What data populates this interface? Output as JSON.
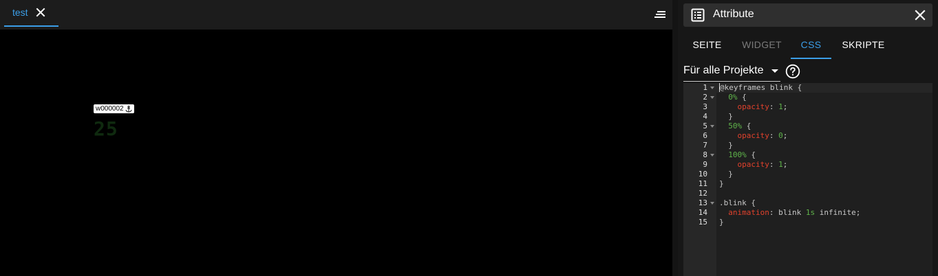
{
  "editor": {
    "tab": {
      "label": "test"
    },
    "widget": {
      "id_label": "w000002",
      "value": "25"
    }
  },
  "panel": {
    "title": "Attribute",
    "tabs": [
      {
        "label": "SEITE",
        "state": "normal"
      },
      {
        "label": "WIDGET",
        "state": "disabled"
      },
      {
        "label": "CSS",
        "state": "active"
      },
      {
        "label": "SKRIPTE",
        "state": "normal"
      }
    ],
    "scope": {
      "selected": "Für alle Projekte"
    },
    "code": {
      "line_numbers": [
        "1",
        "2",
        "3",
        "4",
        "5",
        "6",
        "7",
        "8",
        "9",
        "10",
        "11",
        "12",
        "13",
        "14",
        "15"
      ],
      "foldable_lines": [
        "1",
        "2",
        "5",
        "8",
        "13"
      ],
      "lines": [
        "@keyframes blink {",
        "  0% {",
        "    opacity: 1;",
        "  }",
        "  50% {",
        "    opacity: 0;",
        "  }",
        "  100% {",
        "    opacity: 1;",
        "  }",
        "}",
        "",
        ".blink {",
        "  animation: blink 1s infinite;",
        "}"
      ]
    }
  },
  "icons": {
    "tab_close": "close-icon",
    "menu": "menu-lines-icon",
    "panel": "list-panel-icon",
    "panel_close": "close-icon",
    "help": "help-circle-icon",
    "anchor": "anchor-icon"
  },
  "colors": {
    "accent": "#3b9ee8",
    "css_property": "#e0412c",
    "css_number": "#5fb34a",
    "widget_text": "#0f2a0f"
  }
}
